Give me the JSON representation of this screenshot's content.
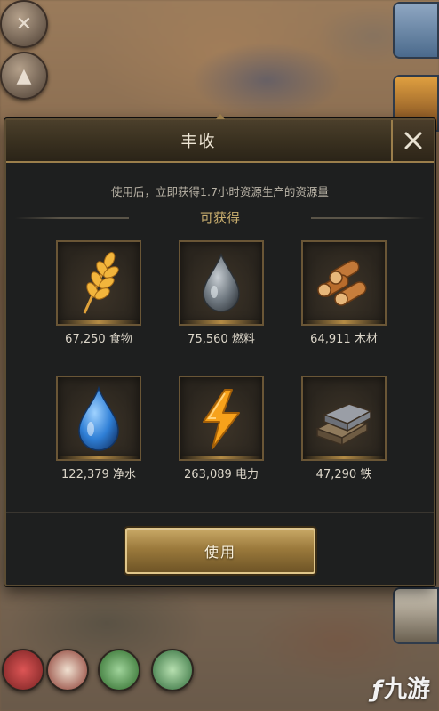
{
  "dialog": {
    "title": "丰收",
    "description": "使用后，立即获得1.7小时资源生产的资源量",
    "available_label": "可获得",
    "use_button": "使用",
    "resources": [
      {
        "name": "食物",
        "amount": "67,250",
        "icon": "wheat-icon"
      },
      {
        "name": "燃料",
        "amount": "75,560",
        "icon": "fuel-drop-icon"
      },
      {
        "name": "木材",
        "amount": "64,911",
        "icon": "wood-logs-icon"
      },
      {
        "name": "净水",
        "amount": "122,379",
        "icon": "water-drop-icon"
      },
      {
        "name": "电力",
        "amount": "263,089",
        "icon": "lightning-icon"
      },
      {
        "name": "铁",
        "amount": "47,290",
        "icon": "iron-ingot-icon"
      }
    ]
  },
  "watermark": {
    "text": "九游"
  },
  "colors": {
    "accent_gold": "#c8ad6e",
    "panel_bg": "#1e1f1f",
    "button_gold": "#9b7a3c"
  }
}
